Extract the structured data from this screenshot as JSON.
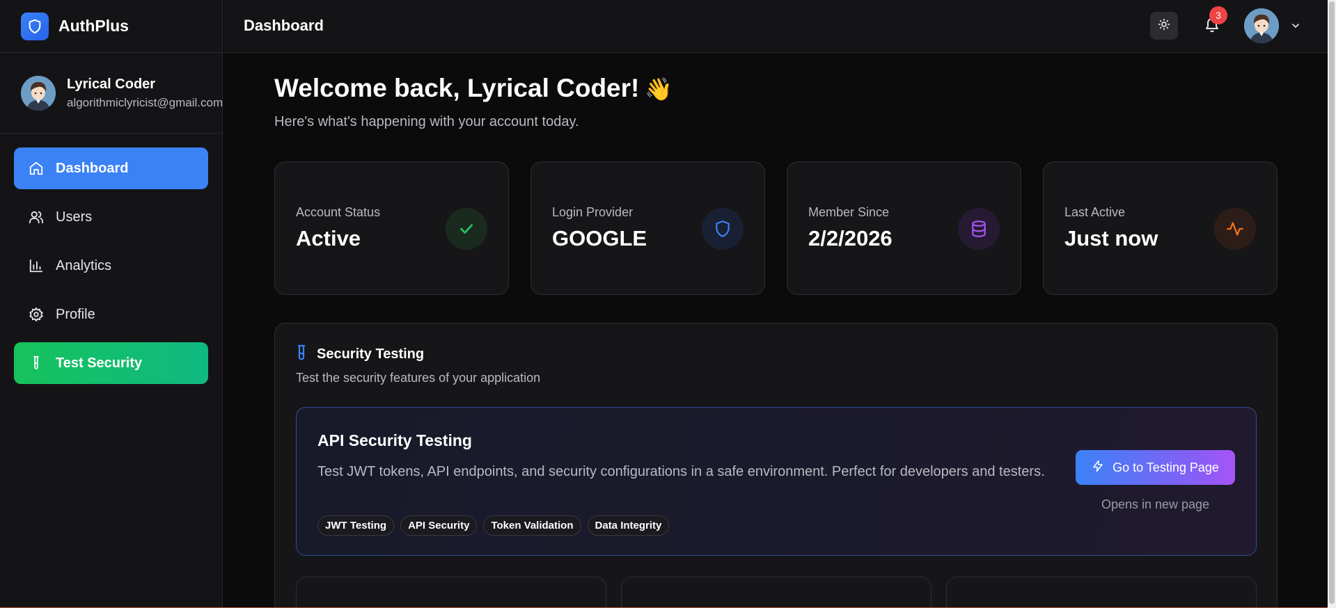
{
  "app": {
    "name": "AuthPlus",
    "brand_color": "#3b82f6"
  },
  "sidebar": {
    "user": {
      "name": "Lyrical Coder",
      "email": "algorithmiclyricist@gmail.com"
    },
    "items": [
      {
        "label": "Dashboard",
        "icon": "home-icon",
        "active": true
      },
      {
        "label": "Users",
        "icon": "users-icon"
      },
      {
        "label": "Analytics",
        "icon": "bar-chart-icon"
      },
      {
        "label": "Profile",
        "icon": "gear-icon"
      },
      {
        "label": "Test Security",
        "icon": "test-tube-icon",
        "highlight": "#16c25b"
      }
    ]
  },
  "header": {
    "title": "Dashboard",
    "notification_count": "3",
    "badge_color": "#ef4444"
  },
  "main": {
    "welcome": "Welcome back, Lyrical Coder!",
    "welcome_emoji": "👋",
    "subtitle": "Here's what's happening with your account today.",
    "stats": [
      {
        "label": "Account Status",
        "value": "Active",
        "icon": "check-icon",
        "color": "#22c55e"
      },
      {
        "label": "Login Provider",
        "value": "GOOGLE",
        "icon": "shield-icon",
        "color": "#3b82f6"
      },
      {
        "label": "Member Since",
        "value": "2/2/2026",
        "icon": "database-icon",
        "color": "#a855f7"
      },
      {
        "label": "Last Active",
        "value": "Just now",
        "icon": "activity-icon",
        "color": "#f97316"
      }
    ],
    "security": {
      "title": "Security Testing",
      "subtitle": "Test the security features of your application",
      "api_card": {
        "title": "API Security Testing",
        "description": "Test JWT tokens, API endpoints, and security configurations in a safe environment. Perfect for developers and testers.",
        "tags": [
          "JWT Testing",
          "API Security",
          "Token Validation",
          "Data Integrity"
        ],
        "button_label": "Go to Testing Page",
        "note": "Opens in new page"
      }
    }
  }
}
